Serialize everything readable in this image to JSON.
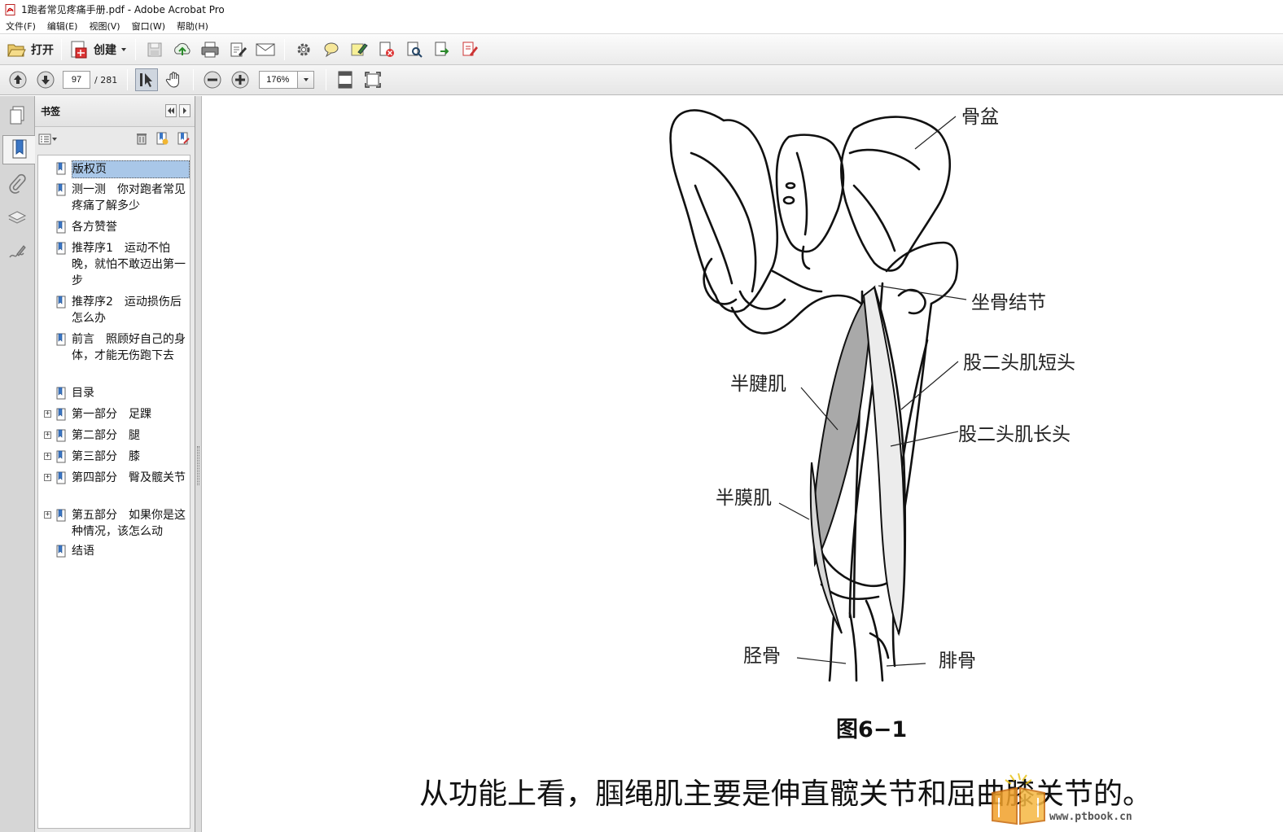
{
  "window": {
    "title": "1跑者常见疼痛手册.pdf - Adobe Acrobat Pro"
  },
  "menu": [
    "文件(F)",
    "编辑(E)",
    "视图(V)",
    "窗口(W)",
    "帮助(H)"
  ],
  "toolbar": {
    "open_label": "打开",
    "create_label": "创建"
  },
  "navigation": {
    "current_page": "97",
    "total_pages": "/ 281",
    "zoom": "176%"
  },
  "bookmarks_panel": {
    "title": "书签",
    "items": [
      {
        "label": "版权页",
        "expandable": false,
        "selected": true
      },
      {
        "label": "测一测　你对跑者常见疼痛了解多少",
        "expandable": false
      },
      {
        "label": "各方赞誉",
        "expandable": false
      },
      {
        "label": "推荐序1　运动不怕晚，就怕不敢迈出第一步",
        "expandable": false
      },
      {
        "label": "推荐序2　运动损伤后怎么办",
        "expandable": false
      },
      {
        "label": "前言　照顾好自己的身体，才能无伤跑下去",
        "expandable": false
      },
      {
        "label": "目录",
        "expandable": false
      },
      {
        "label": "第一部分　足踝",
        "expandable": true
      },
      {
        "label": "第二部分　腿",
        "expandable": true
      },
      {
        "label": "第三部分　膝",
        "expandable": true
      },
      {
        "label": "第四部分　臀及髋关节",
        "expandable": true
      },
      {
        "label": "第五部分　如果你是这种情况，该怎么动",
        "expandable": true
      },
      {
        "label": "结语",
        "expandable": false
      }
    ]
  },
  "document": {
    "figure_labels": {
      "pelvis": "骨盆",
      "ischial_tuberosity": "坐骨结节",
      "biceps_short_head": "股二头肌短头",
      "biceps_long_head": "股二头肌长头",
      "semitendinosus": "半腱肌",
      "semimembranosus": "半膜肌",
      "tibia": "胫骨",
      "fibula": "腓骨"
    },
    "figure_caption": "图6−1",
    "body_text": "从功能上看，腘绳肌主要是伸直髋关节和屈曲膝关节的。",
    "watermark_url": "www.ptbook.cn"
  }
}
